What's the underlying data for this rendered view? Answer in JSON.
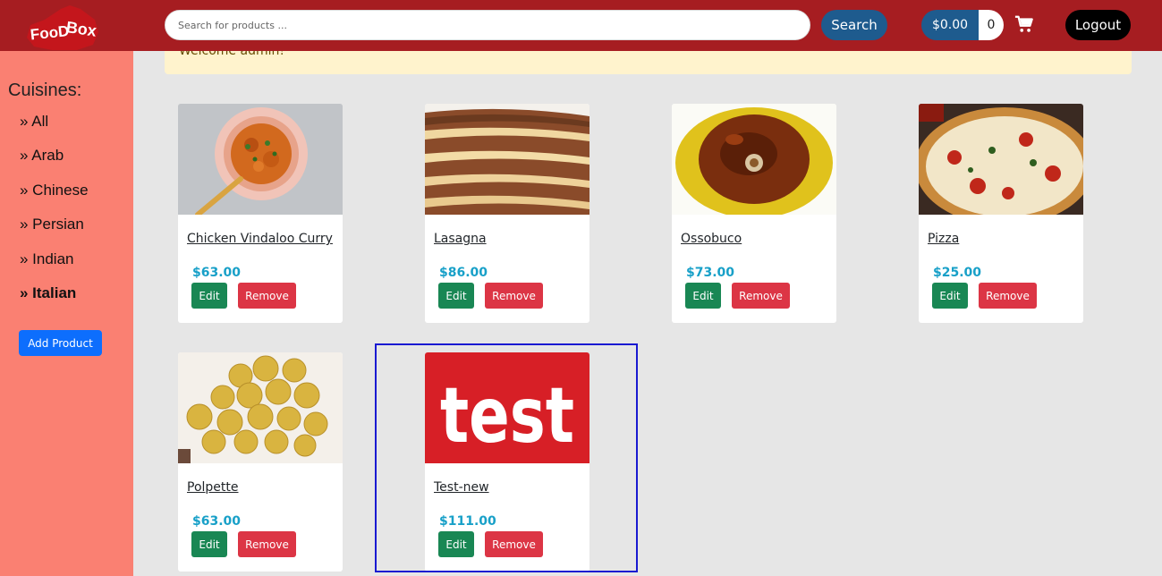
{
  "header": {
    "logo_text": "FooD Box",
    "search": {
      "placeholder": "Search for products ...",
      "button_label": "Search"
    },
    "cart": {
      "total": "$0.00",
      "count": "0",
      "icon": "cart-icon"
    },
    "logout_label": "Logout",
    "colors": {
      "bar": "#a61d21",
      "accent": "#1e5b8e"
    }
  },
  "welcome": {
    "message": "Welcome admin!"
  },
  "sidebar": {
    "title": "Cuisines:",
    "items": [
      {
        "label": "» All",
        "active": false
      },
      {
        "label": "» Arab",
        "active": false
      },
      {
        "label": "» Chinese",
        "active": false
      },
      {
        "label": "» Persian",
        "active": false
      },
      {
        "label": "» Indian",
        "active": false
      },
      {
        "label": "» Italian",
        "active": true
      }
    ],
    "add_product_label": "Add Product",
    "color": "#fa8072"
  },
  "products": [
    {
      "name": "Chicken Vindaloo Curry",
      "price": "$63.00",
      "image": "curry-bowl-image"
    },
    {
      "name": "Lasagna",
      "price": "$86.00",
      "image": "lasagna-image"
    },
    {
      "name": "Ossobuco",
      "price": "$73.00",
      "image": "ossobuco-image"
    },
    {
      "name": "Pizza",
      "price": "$25.00",
      "image": "pizza-image"
    },
    {
      "name": "Polpette",
      "price": "$63.00",
      "image": "polpette-image"
    },
    {
      "name": "Test-new",
      "price": "$111.00",
      "image": "test-logo-image",
      "image_text": "test"
    }
  ],
  "card_actions": {
    "edit_label": "Edit",
    "remove_label": "Remove"
  },
  "colors": {
    "price": "#18a0c8",
    "edit": "#198754",
    "remove": "#dc3545",
    "highlight": "#1a1ad1"
  }
}
